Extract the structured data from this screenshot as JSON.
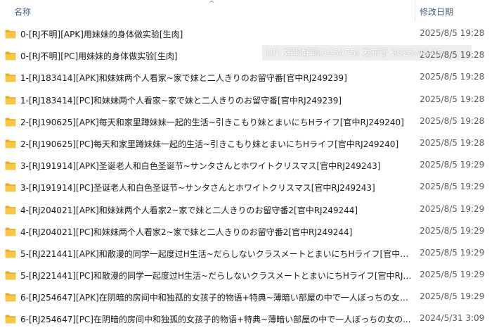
{
  "header": {
    "name_label": "名称",
    "date_label": "修改日期",
    "sort_glyph": "^"
  },
  "watermark": {
    "text": "UP: 好耶好耶(115475) 发布于 2025-08-05"
  },
  "colors": {
    "folder_fill": "#f8c74a",
    "folder_tab": "#e9ac25",
    "header_text": "#4c607a"
  },
  "icons": {
    "folder": "folder-icon"
  },
  "rows": [
    {
      "name": "0-[RJ不明][APK]用妹妹的身体做实验[生肉]",
      "date": "2025/8/5 19:28"
    },
    {
      "name": "0-[RJ不明][PC]用妹妹的身体做实验[生肉]",
      "date": "2025/8/5 19:28"
    },
    {
      "name": "1-[RJ183414][APK]和妹妹两个人看家~家で妹と二人きりのお留守番[官中RJ249239]",
      "date": "2025/8/5 19:28"
    },
    {
      "name": "1-[RJ183414][PC]和妹妹两个人看家~家で妹と二人きりのお留守番[官中RJ249239]",
      "date": "2025/8/5 19:28"
    },
    {
      "name": "2-[RJ190625][APK]每天和家里蹲妹妹一起的生活~引きこもり妹とまいにちHライフ[官中RJ249240]",
      "date": "2025/8/5 19:28"
    },
    {
      "name": "2-[RJ190625][PC]每天和家里蹲妹妹一起的生活~引きこもり妹とまいにちHライフ[官中RJ249240]",
      "date": "2025/8/5 19:28"
    },
    {
      "name": "3-[RJ191914][APK]圣诞老人和白色圣诞节~サンタさんとホワイトクリスマス[官中RJ249243]",
      "date": "2025/8/5 19:29"
    },
    {
      "name": "3-[RJ191914][PC]圣诞老人和白色圣诞节~サンタさんとホワイトクリスマス[官中RJ249243]",
      "date": "2025/8/5 19:29"
    },
    {
      "name": "4-[RJ204021][APK]和妹妹两个人看家2~家で妹と二人きりのお留守番2[官中RJ249244]",
      "date": "2025/8/5 19:29"
    },
    {
      "name": "4-[RJ204021][PC]和妹妹两个人看家2~家で妹と二人きりのお留守番2[官中RJ249244]",
      "date": "2025/8/5 19:29"
    },
    {
      "name": "5-[RJ221441][APK]和散漫的同学一起度过H生活~だらしないクラスメートとまいにちHライフ[官中RJ...",
      "date": "2025/8/5 19:29"
    },
    {
      "name": "5-[RJ221441][PC]和散漫的同学一起度过H生活~だらしないクラスメートとまいにちHライフ[官中RJ2...",
      "date": "2025/8/5 19:29"
    },
    {
      "name": "6-[RJ254647][APK]在阴暗的房间中和独孤的女孩子的物语+特典~薄暗い部屋の中で一人ぼっちの女の...",
      "date": "2025/8/5 19:29"
    },
    {
      "name": "6-[RJ254647][PC]在阴暗的房间中和独孤的女孩子的物语+特典~薄暗い部屋の中で一人ぼっちの女の...",
      "date": "2024/5/31 3:09"
    }
  ]
}
